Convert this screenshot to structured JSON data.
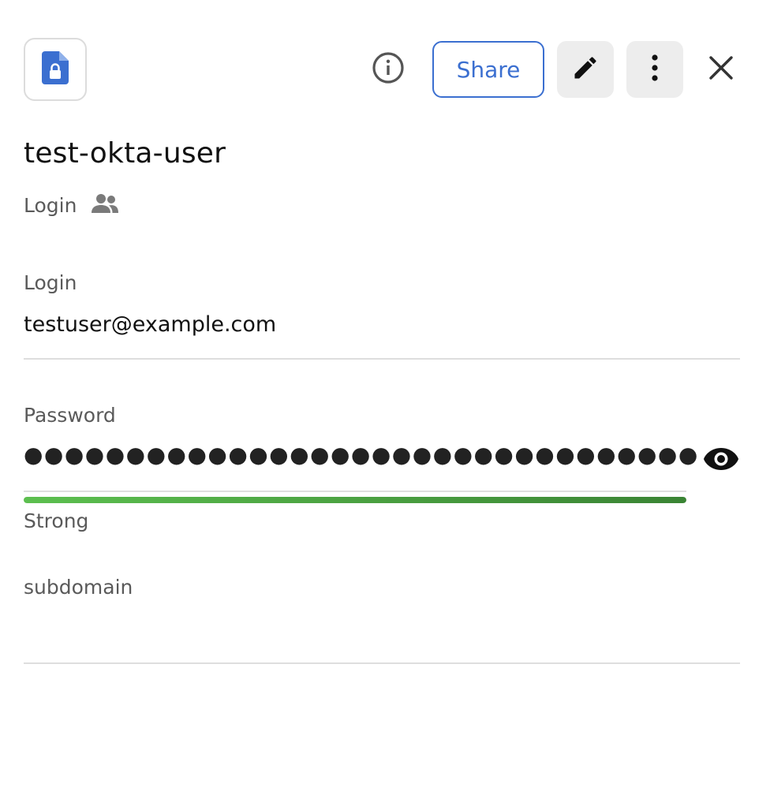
{
  "header": {
    "item_icon": "locked-document-icon",
    "info_icon": "info-icon",
    "share_label": "Share",
    "edit_icon": "pencil-icon",
    "more_icon": "more-vertical-icon",
    "close_icon": "close-icon"
  },
  "item": {
    "title": "test-okta-user",
    "type_label": "Login",
    "shared_icon": "people-icon"
  },
  "fields": {
    "login": {
      "label": "Login",
      "value": "testuser@example.com"
    },
    "password": {
      "label": "Password",
      "masked_value": "●●●●●●●●●●●●●●●●●●●●●●●●●●●●●●●●●",
      "reveal_icon": "eye-icon",
      "strength_label": "Strong",
      "strength_fraction": 1.0
    },
    "subdomain": {
      "label": "subdomain",
      "value": ""
    }
  },
  "colors": {
    "accent": "#3b6fd0",
    "strength_start": "#5cbf4f",
    "strength_end": "#3a8434",
    "button_bg": "#ededed"
  }
}
